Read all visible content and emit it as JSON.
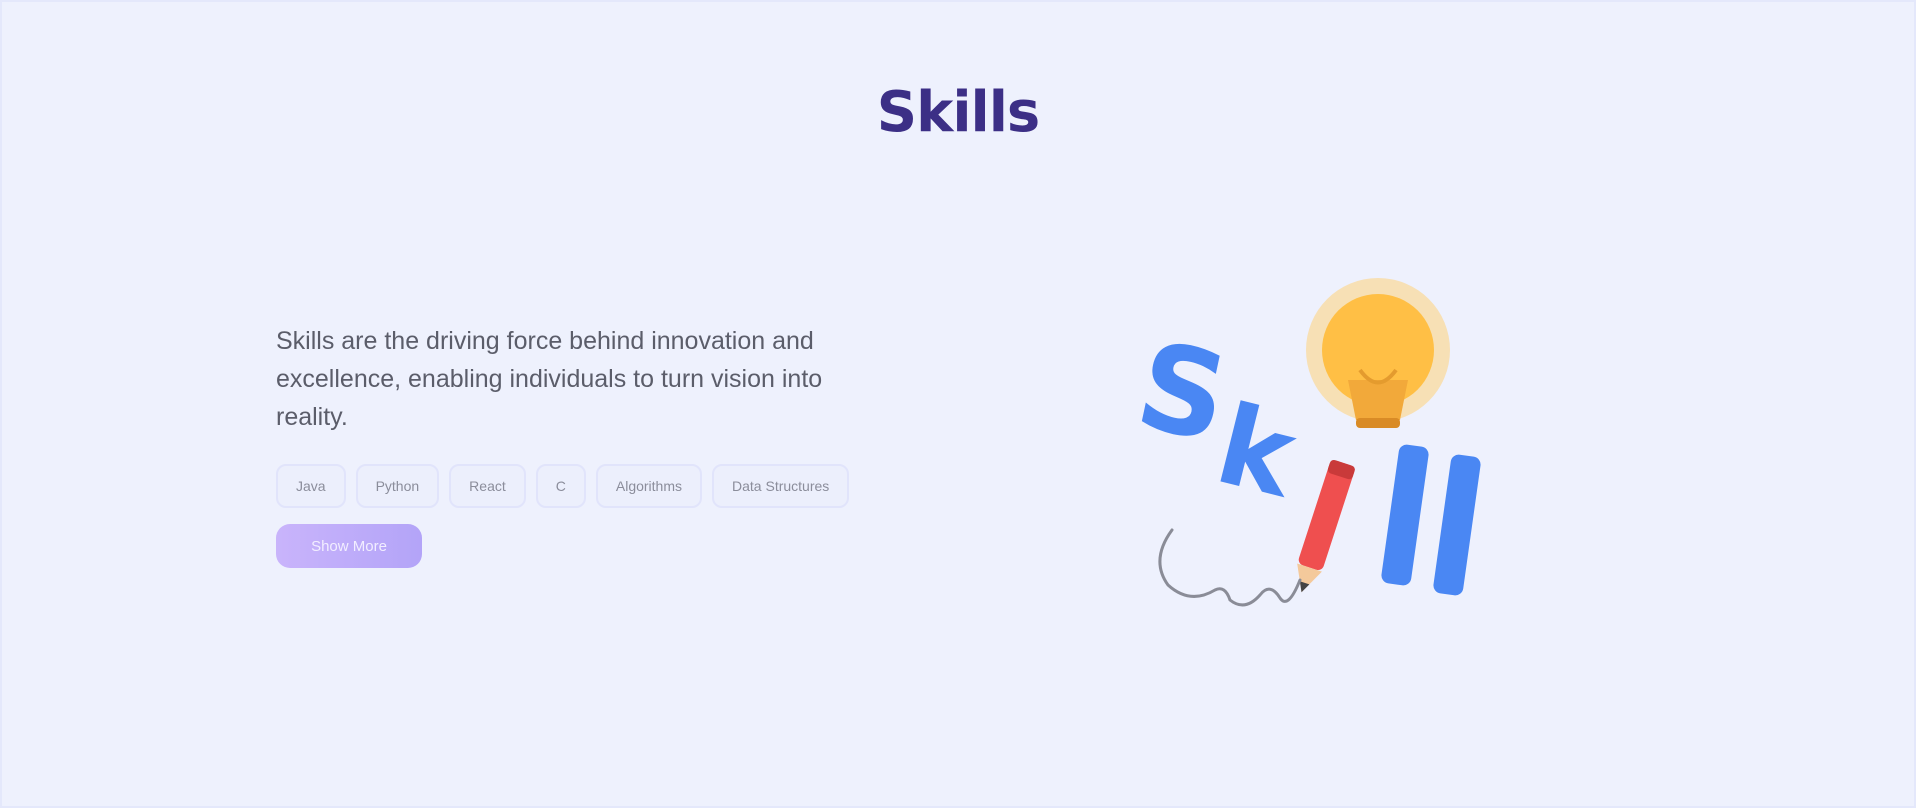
{
  "section": {
    "title": "Skills",
    "description": "Skills are the driving force behind innovation and excellence, enabling individuals to turn vision into reality."
  },
  "chips": [
    "Java",
    "Python",
    "React",
    "C",
    "Algorithms",
    "Data Structures"
  ],
  "more_button_label": "Show More",
  "illustration": {
    "type": "skill-lightbulb-pencil-illustration",
    "text": "Skill",
    "colors": {
      "letters": "#4a87f3",
      "bulb": "#ffbf45",
      "pencil": "#ef4f4f"
    }
  },
  "colors": {
    "background": "#eef1fd",
    "title": "#3c2f86",
    "accent": "#b9a4f9"
  }
}
